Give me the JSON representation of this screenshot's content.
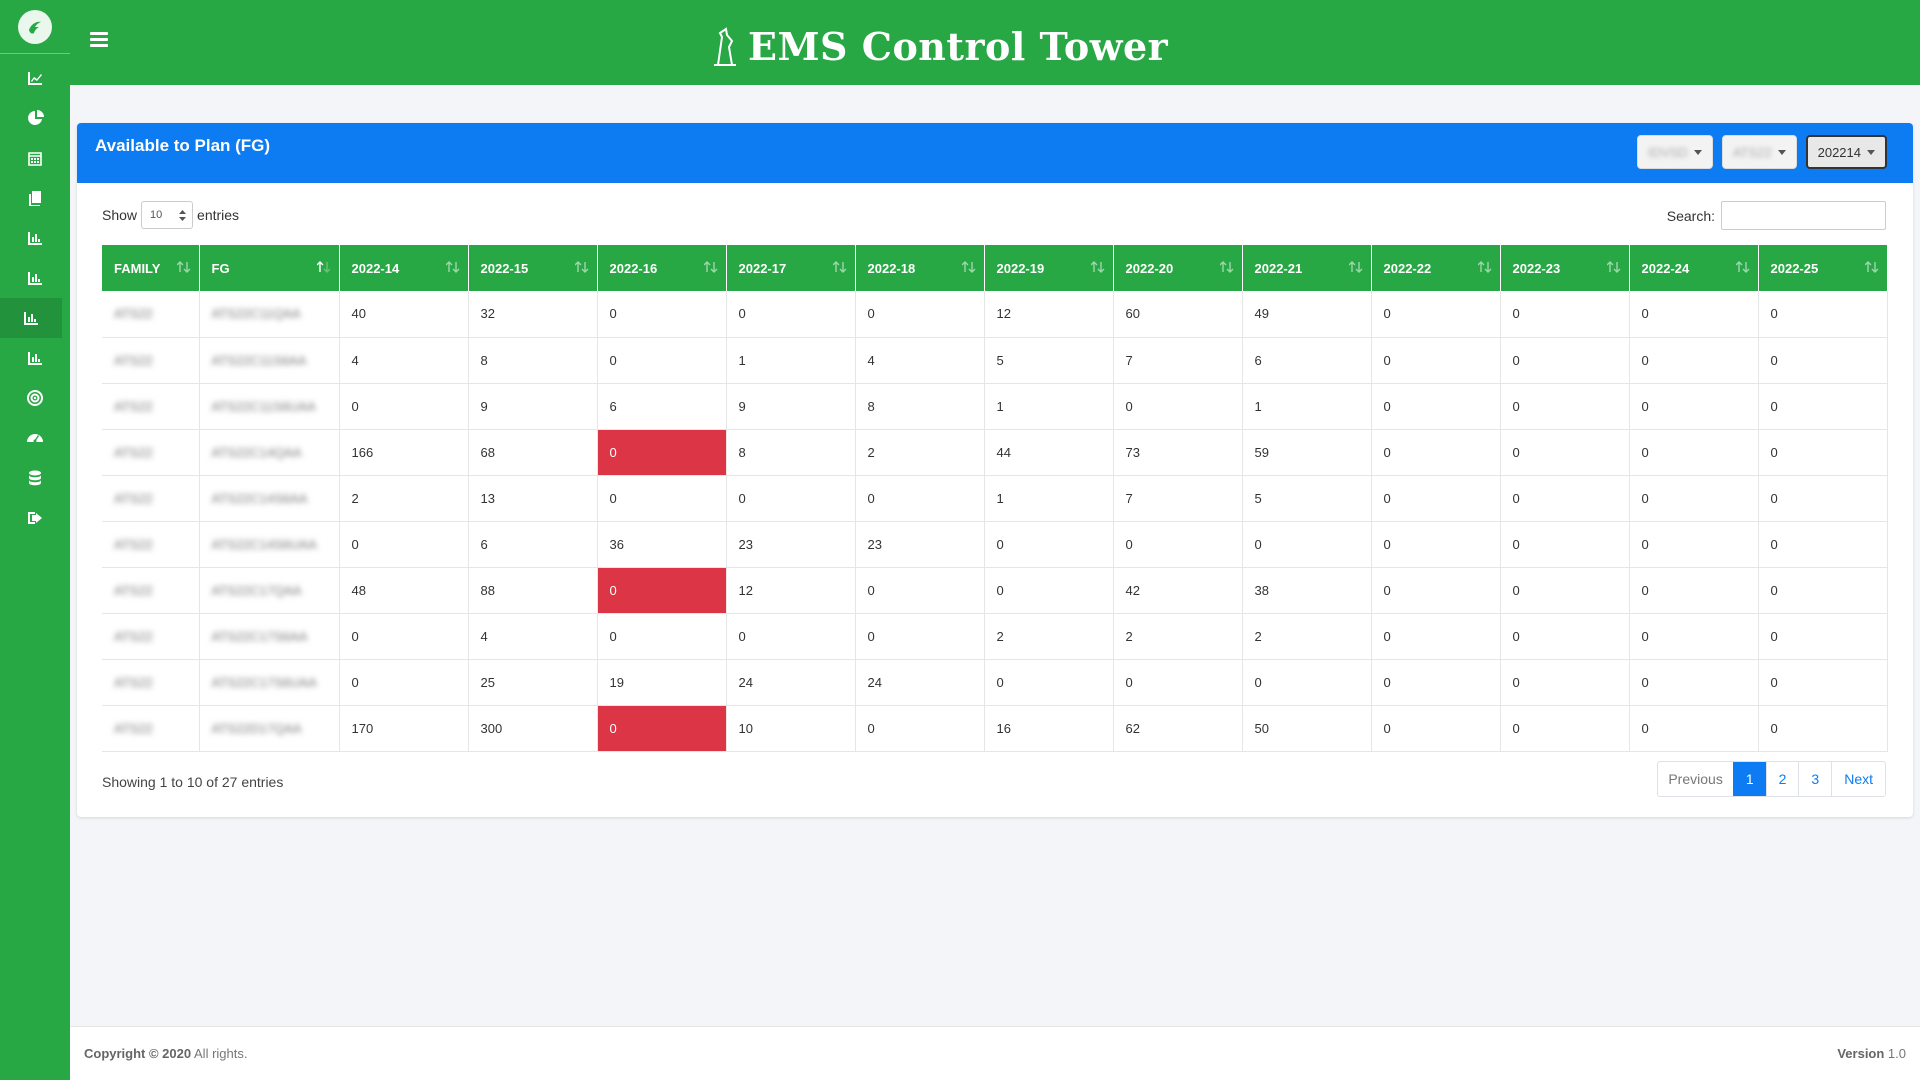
{
  "brand": {
    "title": "EMS Control Tower"
  },
  "sidebar": {
    "items": [
      {
        "icon": "line-chart-icon"
      },
      {
        "icon": "pie-chart-icon"
      },
      {
        "icon": "calendar-icon"
      },
      {
        "icon": "copy-icon"
      },
      {
        "icon": "bar-chart-icon"
      },
      {
        "icon": "bar-chart-icon"
      },
      {
        "icon": "bar-chart-icon",
        "active": true
      },
      {
        "icon": "bar-chart-icon"
      },
      {
        "icon": "target-icon"
      },
      {
        "icon": "gauge-icon"
      },
      {
        "icon": "database-icon"
      },
      {
        "icon": "sign-out-icon"
      }
    ]
  },
  "card": {
    "title": "Available to Plan (FG)",
    "filters": [
      {
        "label": "IDVSD"
      },
      {
        "label": "ATS22"
      },
      {
        "label": "202214"
      }
    ]
  },
  "controls": {
    "show_label": "Show",
    "entries_value": "10",
    "entries_label": "entries",
    "search_label": "Search:"
  },
  "table": {
    "headers": [
      "FAMILY",
      "FG",
      "2022-14",
      "2022-15",
      "2022-16",
      "2022-17",
      "2022-18",
      "2022-19",
      "2022-20",
      "2022-21",
      "2022-22",
      "2022-23",
      "2022-24",
      "2022-25"
    ],
    "rows": [
      {
        "family": "ATS22",
        "fg": "ATS22C11QAA",
        "values": [
          "40",
          "32",
          "0",
          "0",
          "0",
          "12",
          "60",
          "49",
          "0",
          "0",
          "0",
          "0"
        ],
        "flags": []
      },
      {
        "family": "ATS22",
        "fg": "ATS22C11S6AA",
        "values": [
          "4",
          "8",
          "0",
          "1",
          "4",
          "5",
          "7",
          "6",
          "0",
          "0",
          "0",
          "0"
        ],
        "flags": []
      },
      {
        "family": "ATS22",
        "fg": "ATS22C11S6UAA",
        "values": [
          "0",
          "9",
          "6",
          "9",
          "8",
          "1",
          "0",
          "1",
          "0",
          "0",
          "0",
          "0"
        ],
        "flags": []
      },
      {
        "family": "ATS22",
        "fg": "ATS22C14QAA",
        "values": [
          "166",
          "68",
          "0",
          "8",
          "2",
          "44",
          "73",
          "59",
          "0",
          "0",
          "0",
          "0"
        ],
        "flags": [
          2
        ]
      },
      {
        "family": "ATS22",
        "fg": "ATS22C14S6AA",
        "values": [
          "2",
          "13",
          "0",
          "0",
          "0",
          "1",
          "7",
          "5",
          "0",
          "0",
          "0",
          "0"
        ],
        "flags": []
      },
      {
        "family": "ATS22",
        "fg": "ATS22C14S6UAA",
        "values": [
          "0",
          "6",
          "36",
          "23",
          "23",
          "0",
          "0",
          "0",
          "0",
          "0",
          "0",
          "0"
        ],
        "flags": []
      },
      {
        "family": "ATS22",
        "fg": "ATS22C17QAA",
        "values": [
          "48",
          "88",
          "0",
          "12",
          "0",
          "0",
          "42",
          "38",
          "0",
          "0",
          "0",
          "0"
        ],
        "flags": [
          2
        ]
      },
      {
        "family": "ATS22",
        "fg": "ATS22C17S6AA",
        "values": [
          "0",
          "4",
          "0",
          "0",
          "0",
          "2",
          "2",
          "2",
          "0",
          "0",
          "0",
          "0"
        ],
        "flags": []
      },
      {
        "family": "ATS22",
        "fg": "ATS22C17S6UAA",
        "values": [
          "0",
          "25",
          "19",
          "24",
          "24",
          "0",
          "0",
          "0",
          "0",
          "0",
          "0",
          "0"
        ],
        "flags": []
      },
      {
        "family": "ATS22",
        "fg": "ATS22D17QAA",
        "values": [
          "170",
          "300",
          "0",
          "10",
          "0",
          "16",
          "62",
          "50",
          "0",
          "0",
          "0",
          "0"
        ],
        "flags": [
          2
        ]
      }
    ]
  },
  "info": "Showing 1 to 10 of 27 entries",
  "pagination": {
    "previous": "Previous",
    "pages": [
      "1",
      "2",
      "3"
    ],
    "current": "1",
    "next": "Next"
  },
  "footer": {
    "copyright_bold": "Copyright © 2020",
    "copyright_rest": " All rights.",
    "version_bold": "Version",
    "version_rest": " 1.0"
  },
  "colors": {
    "primary_green": "#28a745",
    "header_blue": "#0d7cf2",
    "flag_red": "#dc3545"
  }
}
